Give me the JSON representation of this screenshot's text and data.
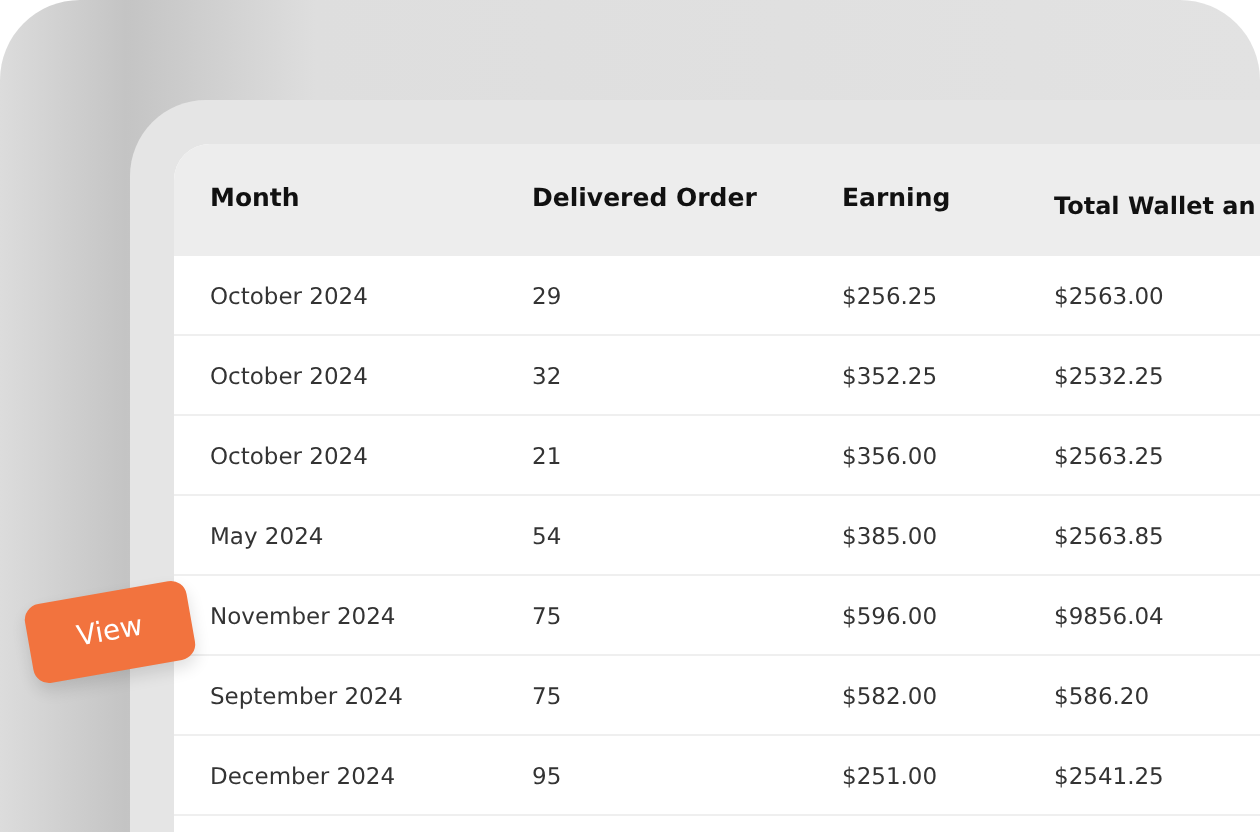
{
  "table": {
    "columns": [
      "Month",
      "Delivered Order",
      "Earning",
      "Total Wallet an"
    ],
    "rows": [
      [
        "October 2024",
        "29",
        "$256.25",
        "$2563.00"
      ],
      [
        "October 2024",
        "32",
        "$352.25",
        "$2532.25"
      ],
      [
        "October 2024",
        "21",
        "$356.00",
        "$2563.25"
      ],
      [
        "May 2024",
        "54",
        "$385.00",
        "$2563.85"
      ],
      [
        "November 2024",
        "75",
        "$596.00",
        "$9856.04"
      ],
      [
        "September 2024",
        "75",
        "$582.00",
        "$586.20"
      ],
      [
        "December 2024",
        "95",
        "$251.00",
        "$2541.25"
      ]
    ]
  },
  "badge": {
    "label": "View"
  }
}
